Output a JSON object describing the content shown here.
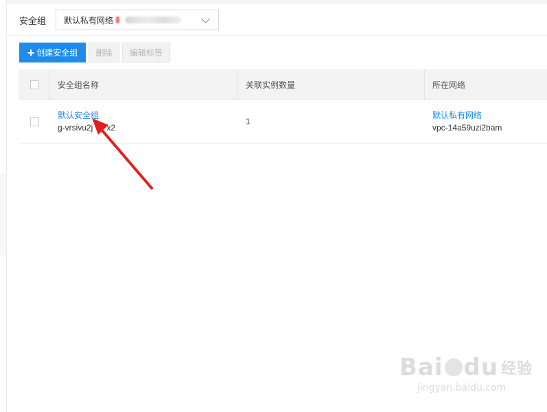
{
  "filter": {
    "label": "安全组",
    "vpc_selected": "默认私有网络"
  },
  "toolbar": {
    "create_label": "创建安全组",
    "delete_label": "删除",
    "edit_tags_label": "编辑标签"
  },
  "table": {
    "headers": {
      "name": "安全组名称",
      "instance_count": "关联实例数量",
      "network": "所在网络"
    },
    "rows": [
      {
        "name": "默认安全组",
        "id": "g-vrsivu2j",
        "id_tail": "x2",
        "instance_count": "1",
        "network_name": "默认私有网络",
        "network_id": "vpc-14a59uzi2bam"
      }
    ]
  },
  "watermark": {
    "brand": "Bai",
    "brand_tail": "du",
    "product": "经验",
    "url": "jingyan.baidu.com"
  },
  "colors": {
    "accent": "#1e8ce8",
    "annotation_arrow": "#e02020"
  }
}
